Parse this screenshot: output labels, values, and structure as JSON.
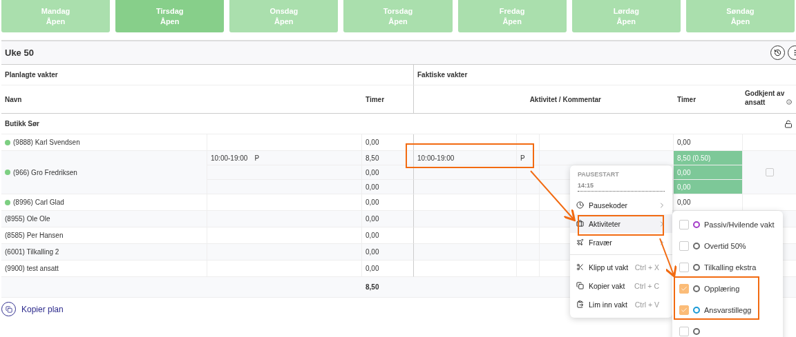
{
  "days": [
    {
      "name": "Mandag",
      "status": "Åpen",
      "selected": false
    },
    {
      "name": "Tirsdag",
      "status": "Åpen",
      "selected": true
    },
    {
      "name": "Onsdag",
      "status": "Åpen",
      "selected": false
    },
    {
      "name": "Torsdag",
      "status": "Åpen",
      "selected": false
    },
    {
      "name": "Fredag",
      "status": "Åpen",
      "selected": false
    },
    {
      "name": "Lørdag",
      "status": "Åpen",
      "selected": false
    },
    {
      "name": "Søndag",
      "status": "Åpen",
      "selected": false
    }
  ],
  "week": "Uke 50",
  "sections": {
    "planned": "Planlagte vakter",
    "actual": "Faktiske vakter"
  },
  "columns": {
    "name": "Navn",
    "planned_hours": "Timer",
    "activity": "Aktivitet / Kommentar",
    "actual_hours": "Timer",
    "approved": "Godkjent av ansatt"
  },
  "group": "Butikk Sør",
  "employees": [
    {
      "name": "(9888) Karl Svendsen",
      "online": true,
      "shifts": [
        {
          "planned_hours": "0,00",
          "actual_hours": "0,00",
          "registered": false
        }
      ]
    },
    {
      "name": "(966) Gro Fredriksen",
      "online": true,
      "approved": false,
      "shifts": [
        {
          "planned": "10:00-19:00",
          "planned_code": "P",
          "planned_hours": "8,50",
          "actual": "10:00-19:00",
          "actual_code": "P",
          "actual_hours": "8,50 (0.50)",
          "registered": true
        },
        {
          "planned_hours": "0,00",
          "actual_hours": "0,00",
          "registered": true
        },
        {
          "planned_hours": "0,00",
          "actual_hours": "0,00",
          "registered": true
        }
      ]
    },
    {
      "name": "(8996) Carl Glad",
      "online": true,
      "shifts": [
        {
          "planned_hours": "0,00",
          "actual_hours": "0,00",
          "registered": false
        }
      ]
    },
    {
      "name": "(8955) Ole Ole",
      "online": false,
      "shifts": [
        {
          "planned_hours": "0,00"
        }
      ]
    },
    {
      "name": "(8585) Per Hansen",
      "online": false,
      "shifts": [
        {
          "planned_hours": "0,00"
        }
      ]
    },
    {
      "name": "(6001) Tilkalling 2",
      "online": false,
      "shifts": [
        {
          "planned_hours": "0,00"
        }
      ]
    },
    {
      "name": "(9900) test ansatt",
      "online": false,
      "shifts": [
        {
          "planned_hours": "0,00"
        }
      ]
    }
  ],
  "total": "8,50",
  "copy_plan": "Kopier plan",
  "context_menu": {
    "header": "PAUSESTART",
    "time": "14:15",
    "items": [
      {
        "kind": "submenu",
        "label": "Pausekoder",
        "selected": false
      },
      {
        "kind": "submenu",
        "label": "Aktiviteter",
        "selected": true
      },
      {
        "kind": "submenu",
        "label": "Fravær",
        "selected": false
      },
      {
        "kind": "action",
        "label": "Klipp ut vakt",
        "shortcut": "Ctrl + X"
      },
      {
        "kind": "action",
        "label": "Kopier vakt",
        "shortcut": "Ctrl + C"
      },
      {
        "kind": "action",
        "label": "Lim inn vakt",
        "shortcut": "Ctrl + V"
      }
    ]
  },
  "activities": [
    {
      "label": "Passiv/Hvilende vakt",
      "color": "#a43cc8",
      "checked": false
    },
    {
      "label": "Overtid 50%",
      "color": "#6b6b6b",
      "checked": false
    },
    {
      "label": "Tilkalling ekstra",
      "color": "#6b6b6b",
      "checked": false
    },
    {
      "label": "Opplæring",
      "color": "#6b6b6b",
      "checked": true
    },
    {
      "label": "Ansvarstillegg",
      "color": "#1a9ad6",
      "checked": true
    },
    {
      "color": "#6b6b6b",
      "checked": false
    }
  ]
}
